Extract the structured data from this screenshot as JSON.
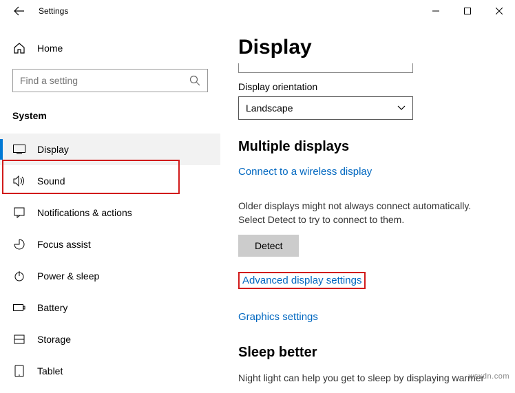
{
  "titlebar": {
    "title": "Settings"
  },
  "sidebar": {
    "home": "Home",
    "search_placeholder": "Find a setting",
    "section": "System",
    "items": [
      {
        "label": "Display",
        "selected": true
      },
      {
        "label": "Sound"
      },
      {
        "label": "Notifications & actions"
      },
      {
        "label": "Focus assist"
      },
      {
        "label": "Power & sleep"
      },
      {
        "label": "Battery"
      },
      {
        "label": "Storage"
      },
      {
        "label": "Tablet"
      }
    ]
  },
  "content": {
    "heading": "Display",
    "orientation_label": "Display orientation",
    "orientation_value": "Landscape",
    "multiple_displays_heading": "Multiple displays",
    "connect_wireless": "Connect to a wireless display",
    "detect_desc": "Older displays might not always connect automatically. Select Detect to try to connect to them.",
    "detect_btn": "Detect",
    "advanced_link": "Advanced display settings",
    "graphics_link": "Graphics settings",
    "sleep_heading": "Sleep better",
    "sleep_desc": "Night light can help you get to sleep by displaying warmer"
  },
  "watermark": "wsxdn.com"
}
